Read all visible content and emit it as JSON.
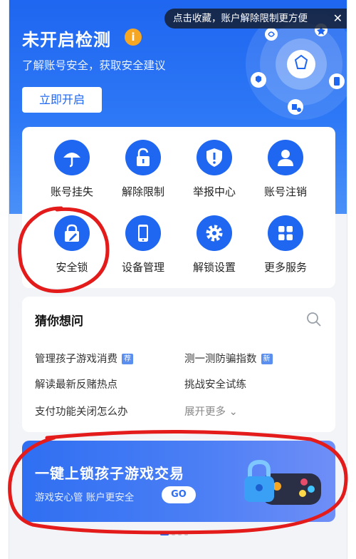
{
  "banner_tip": {
    "text": "点击收藏，账户解除限制更方便",
    "close": "✕"
  },
  "header": {
    "title": "未开启检测",
    "info": "i",
    "subtitle": "了解账号安全，获取安全建议",
    "start_button": "立即开启"
  },
  "services": [
    {
      "label": "账号挂失",
      "icon": "umbrella-icon"
    },
    {
      "label": "解除限制",
      "icon": "unlock-icon"
    },
    {
      "label": "举报中心",
      "icon": "shield-alert-icon"
    },
    {
      "label": "账号注销",
      "icon": "user-icon"
    },
    {
      "label": "安全锁",
      "icon": "lock-pen-icon"
    },
    {
      "label": "设备管理",
      "icon": "phone-icon"
    },
    {
      "label": "解锁设置",
      "icon": "gear-icon"
    },
    {
      "label": "更多服务",
      "icon": "grid-icon"
    }
  ],
  "guess": {
    "title": "猜你想问",
    "questions": [
      {
        "text": "管理孩子游戏消费",
        "tag": "荐"
      },
      {
        "text": "测一测防骗指数",
        "tag": "新"
      },
      {
        "text": "解读最新反赌热点",
        "tag": ""
      },
      {
        "text": "挑战安全试练",
        "tag": ""
      },
      {
        "text": "支付功能关闭怎么办",
        "tag": ""
      }
    ],
    "expand": "展开更多"
  },
  "promo": {
    "title": "一键上锁孩子游戏交易",
    "subtitle": "游戏安心管 账户更安全",
    "button": "GO"
  },
  "colors": {
    "primary": "#1f66f0",
    "accent": "#f5a623",
    "annotation": "#e31b1b"
  }
}
